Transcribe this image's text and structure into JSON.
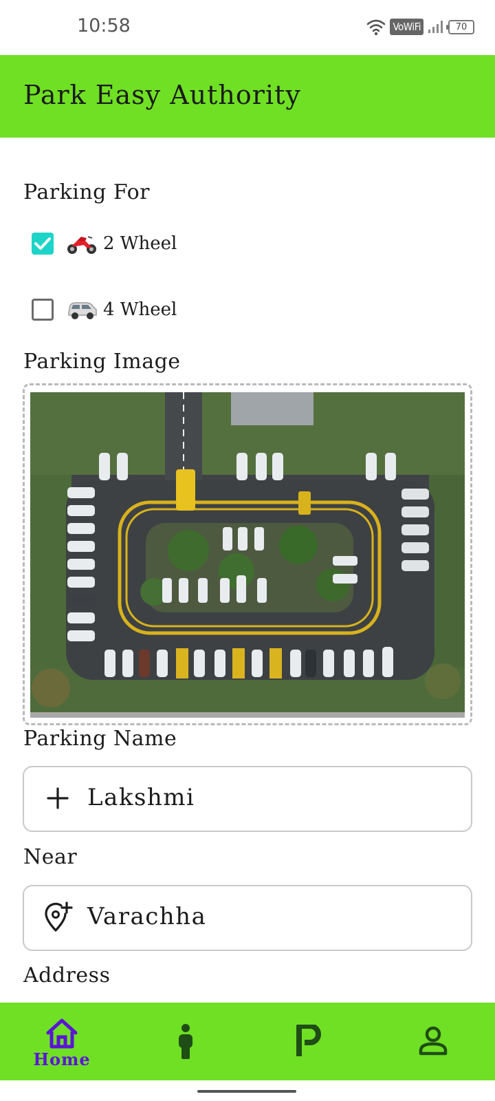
{
  "status_bar": {
    "time": "10:58",
    "vowifi": "VoWiFi",
    "battery": "70"
  },
  "app_bar": {
    "title": "Park Easy Authority",
    "color": "#6fe024"
  },
  "form": {
    "parking_for_label": "Parking For",
    "options": [
      {
        "label": "2 Wheel",
        "checked": true,
        "icon": "motorcycle-icon"
      },
      {
        "label": "4 Wheel",
        "checked": false,
        "icon": "car-icon"
      }
    ],
    "parking_image_label": "Parking Image",
    "parking_name_label": "Parking Name",
    "parking_name_value": "Lakshmi",
    "near_label": "Near",
    "near_value": "Varachha",
    "address_label": "Address"
  },
  "bottom_nav": {
    "items": [
      {
        "label": "Home",
        "icon": "home-icon",
        "active": true
      },
      {
        "label": "",
        "icon": "person-icon",
        "active": false
      },
      {
        "label": "",
        "icon": "parking-icon",
        "active": false
      },
      {
        "label": "",
        "icon": "profile-icon",
        "active": false
      }
    ],
    "active_color": "#5b14d6",
    "inactive_color": "#1f4d16"
  },
  "colors": {
    "accent_green": "#6fe024",
    "checkbox_checked": "#1ed4c8"
  }
}
